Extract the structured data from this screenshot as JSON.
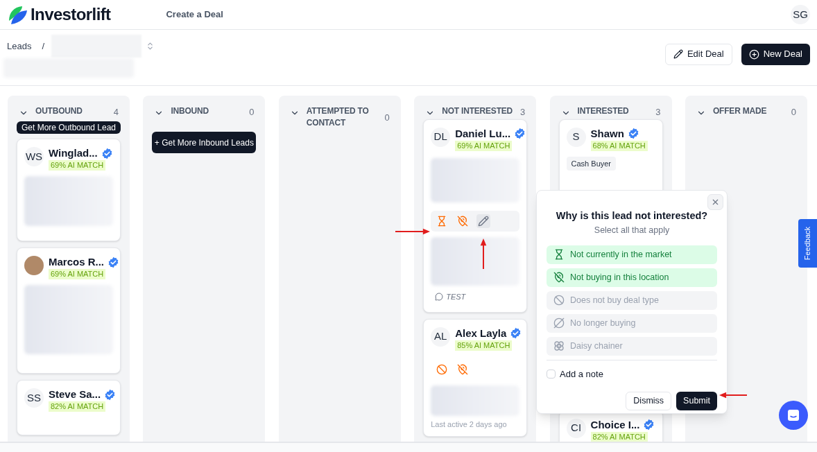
{
  "header": {
    "logo_text": "Investorlift",
    "nav_link": "Create a Deal",
    "user_initials": "SG"
  },
  "breadcrumb": {
    "root": "Leads",
    "separator": "/"
  },
  "actions": [
    {
      "kind": "edit",
      "label": "Edit Deal"
    },
    {
      "kind": "new",
      "label": "New Deal"
    }
  ],
  "columns": [
    {
      "title": "OUTBOUND",
      "count": "4",
      "expanded": true,
      "action_button": "Get More Outbound Lead",
      "cards": [
        {
          "initials": "WS",
          "name": "Winglad...",
          "verified": true,
          "match": "69% AI MATCH"
        },
        {
          "name": "Marcos R...",
          "verified": true,
          "match": "69% AI MATCH"
        },
        {
          "initials": "SS",
          "name": "Steve Sa...",
          "verified": true,
          "match": "82% AI MATCH"
        }
      ]
    },
    {
      "title": "INBOUND",
      "count": "0",
      "expanded": true,
      "action_button": "+ Get More Inbound Leads"
    },
    {
      "title": "ATTEMPTED TO CONTACT",
      "count": "0",
      "expanded": true
    },
    {
      "title": "NOT INTERESTED",
      "count": "3",
      "expanded": true,
      "cards": [
        {
          "initials": "DL",
          "name": "Daniel Lu...",
          "verified": true,
          "match": "69% AI MATCH",
          "reason_bar": true,
          "reasons": [
            {
              "kind": "hourglass",
              "hovered": false
            },
            {
              "kind": "pin_off",
              "hovered": false
            },
            {
              "kind": "edit",
              "hovered": true
            }
          ],
          "note": "TEST"
        },
        {
          "initials": "AL",
          "name": "Alex Layla",
          "verified": true,
          "match": "85% AI MATCH",
          "reason_bar": false,
          "reasons": [
            {
              "kind": "ban",
              "hovered": false
            },
            {
              "kind": "pin_off",
              "hovered": false
            }
          ],
          "last_active": "Last active 2 days ago"
        }
      ]
    },
    {
      "title": "INTERESTED",
      "count": "3",
      "expanded": true,
      "cards": [
        {
          "initials": "S",
          "name": "Shawn",
          "verified": true,
          "match": "68% AI MATCH",
          "tag": "Cash Buyer"
        },
        {
          "initials": "CI",
          "name": "Choice I...",
          "verified": true,
          "match": "82% AI MATCH"
        }
      ]
    },
    {
      "title": "OFFER MADE",
      "count": "0",
      "expanded": true
    }
  ],
  "popover": {
    "title": "Why is this lead not interested?",
    "subtitle": "Select all that apply",
    "reasons": [
      {
        "kind": "hourglass",
        "label": "Not currently in the market",
        "selected": true
      },
      {
        "kind": "pin_off",
        "label": "Not buying in this location",
        "selected": true
      },
      {
        "kind": "ban",
        "label": "Does not buy deal type",
        "selected": false
      },
      {
        "kind": "slash",
        "label": "No longer buying",
        "selected": false
      },
      {
        "kind": "flower",
        "label": "Daisy chainer",
        "selected": false
      }
    ],
    "note_checkbox": {
      "label": "Add a note",
      "checked": false
    },
    "dismiss": "Dismiss",
    "submit": "Submit"
  },
  "feedback": "Feedback"
}
